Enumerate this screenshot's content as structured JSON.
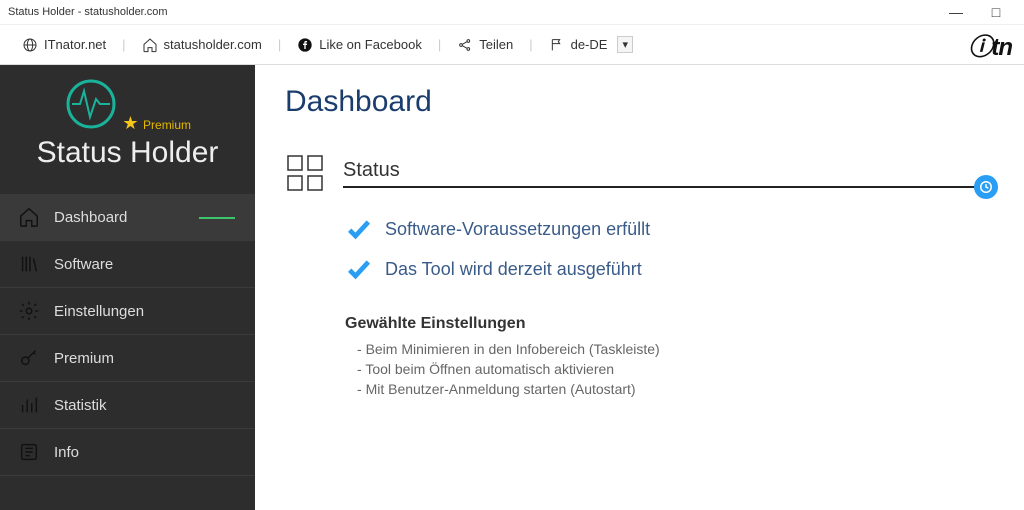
{
  "window": {
    "title": "Status Holder - statusholder.com",
    "minimize": "—",
    "maximize": "□"
  },
  "toolbar": {
    "itnator": "ITnator.net",
    "statusholder": "statusholder.com",
    "facebook": "Like on Facebook",
    "share": "Teilen",
    "lang": "de-DE",
    "lang_caret": "▾",
    "brand": "ⓘtn"
  },
  "logo": {
    "premium_star": "★",
    "premium_label": "Premium",
    "app_name": "Status Holder"
  },
  "sidebar": {
    "items": [
      {
        "label": "Dashboard"
      },
      {
        "label": "Software"
      },
      {
        "label": "Einstellungen"
      },
      {
        "label": "Premium"
      },
      {
        "label": "Statistik"
      },
      {
        "label": "Info"
      }
    ]
  },
  "page": {
    "title": "Dashboard",
    "status_label": "Status",
    "checks": [
      "Software-Voraussetzungen erfüllt",
      "Das Tool wird derzeit ausgeführt"
    ],
    "settings_title": "Gewählte Einstellungen",
    "settings": [
      "Beim Minimieren in den Infobereich (Taskleiste)",
      "Tool beim Öffnen automatisch aktivieren",
      "Mit Benutzer-Anmeldung starten (Autostart)"
    ]
  },
  "colors": {
    "accent": "#2a9df4",
    "sidebar": "#2d2d2d",
    "premium": "#e6b800",
    "active_line": "#3cc46b"
  }
}
